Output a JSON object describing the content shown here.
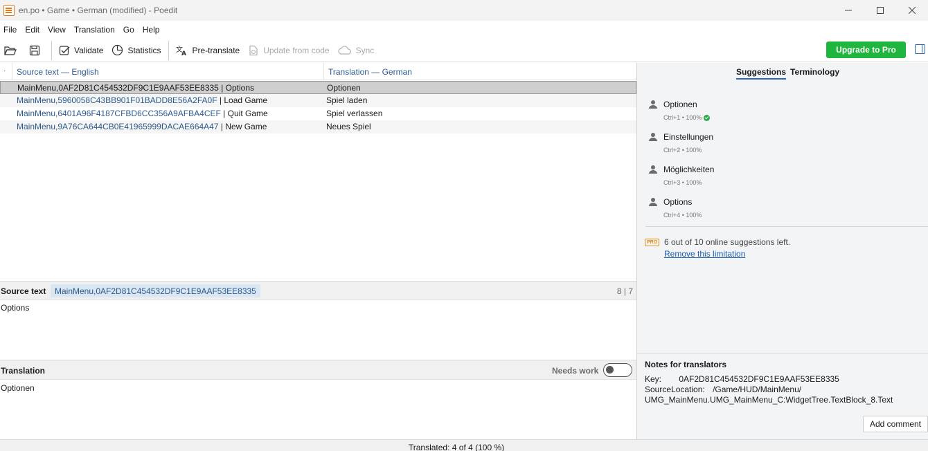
{
  "window": {
    "title": "en.po • Game • German (modified) - Poedit"
  },
  "menu": [
    "File",
    "Edit",
    "View",
    "Translation",
    "Go",
    "Help"
  ],
  "toolbar": {
    "validate": "Validate",
    "statistics": "Statistics",
    "pretranslate": "Pre-translate",
    "update_from_code": "Update from code",
    "sync": "Sync",
    "upgrade": "Upgrade to Pro"
  },
  "list": {
    "dot": "·",
    "source_header": "Source text — English",
    "translation_header": "Translation — German",
    "rows": [
      {
        "key": "MainMenu,0AF2D81C454532DF9C1E9AAF53EE8335",
        "sep": "|",
        "source": "Options",
        "translation": "Optionen",
        "selected": true
      },
      {
        "key": "MainMenu,5960058C43BB901F01BADD8E56A2FA0F",
        "sep": "|",
        "source": "Load Game",
        "translation": "Spiel laden"
      },
      {
        "key": "MainMenu,6401A96F4187CFBD6CC356A9AFBA4CEF",
        "sep": "|",
        "source": "Quit Game",
        "translation": "Spiel verlassen"
      },
      {
        "key": "MainMenu,9A76CA644CB0E41965999DACAE664A47",
        "sep": "|",
        "source": "New Game",
        "translation": "Neues Spiel"
      }
    ]
  },
  "source_panel": {
    "label": "Source text",
    "context": "MainMenu,0AF2D81C454532DF9C1E9AAF53EE8335",
    "count": "8 | 7",
    "text": "Options"
  },
  "translation_panel": {
    "label": "Translation",
    "needs_work": "Needs work",
    "needs_work_on": false,
    "text": "Optionen"
  },
  "sidebar": {
    "tabs": [
      "Suggestions",
      "Terminology"
    ],
    "suggestions": [
      {
        "text": "Optionen",
        "meta": "Ctrl+1 • 100%",
        "verified": true
      },
      {
        "text": "Einstellungen",
        "meta": "Ctrl+2 • 100%"
      },
      {
        "text": "Möglichkeiten",
        "meta": "Ctrl+3 • 100%"
      },
      {
        "text": "Options",
        "meta": "Ctrl+4 • 100%"
      }
    ],
    "pro_badge": "PRO",
    "pro_text": "6 out of 10 online suggestions left.",
    "pro_link": "Remove this limitation",
    "notes": {
      "title": "Notes for translators",
      "key_label": "Key:",
      "key_value": "0AF2D81C454532DF9C1E9AAF53EE8335",
      "location_label": "SourceLocation:",
      "location_value": "/Game/HUD/MainMenu/",
      "location_line2": "UMG_MainMenu.UMG_MainMenu_C:WidgetTree.TextBlock_8.Text",
      "add_comment": "Add comment"
    }
  },
  "status": {
    "text": "Translated: 4 of 4 (100 %)"
  },
  "colors": {
    "accent": "#2a66b3",
    "upgrade": "#1fb53f",
    "link": "#2c5a8f"
  }
}
